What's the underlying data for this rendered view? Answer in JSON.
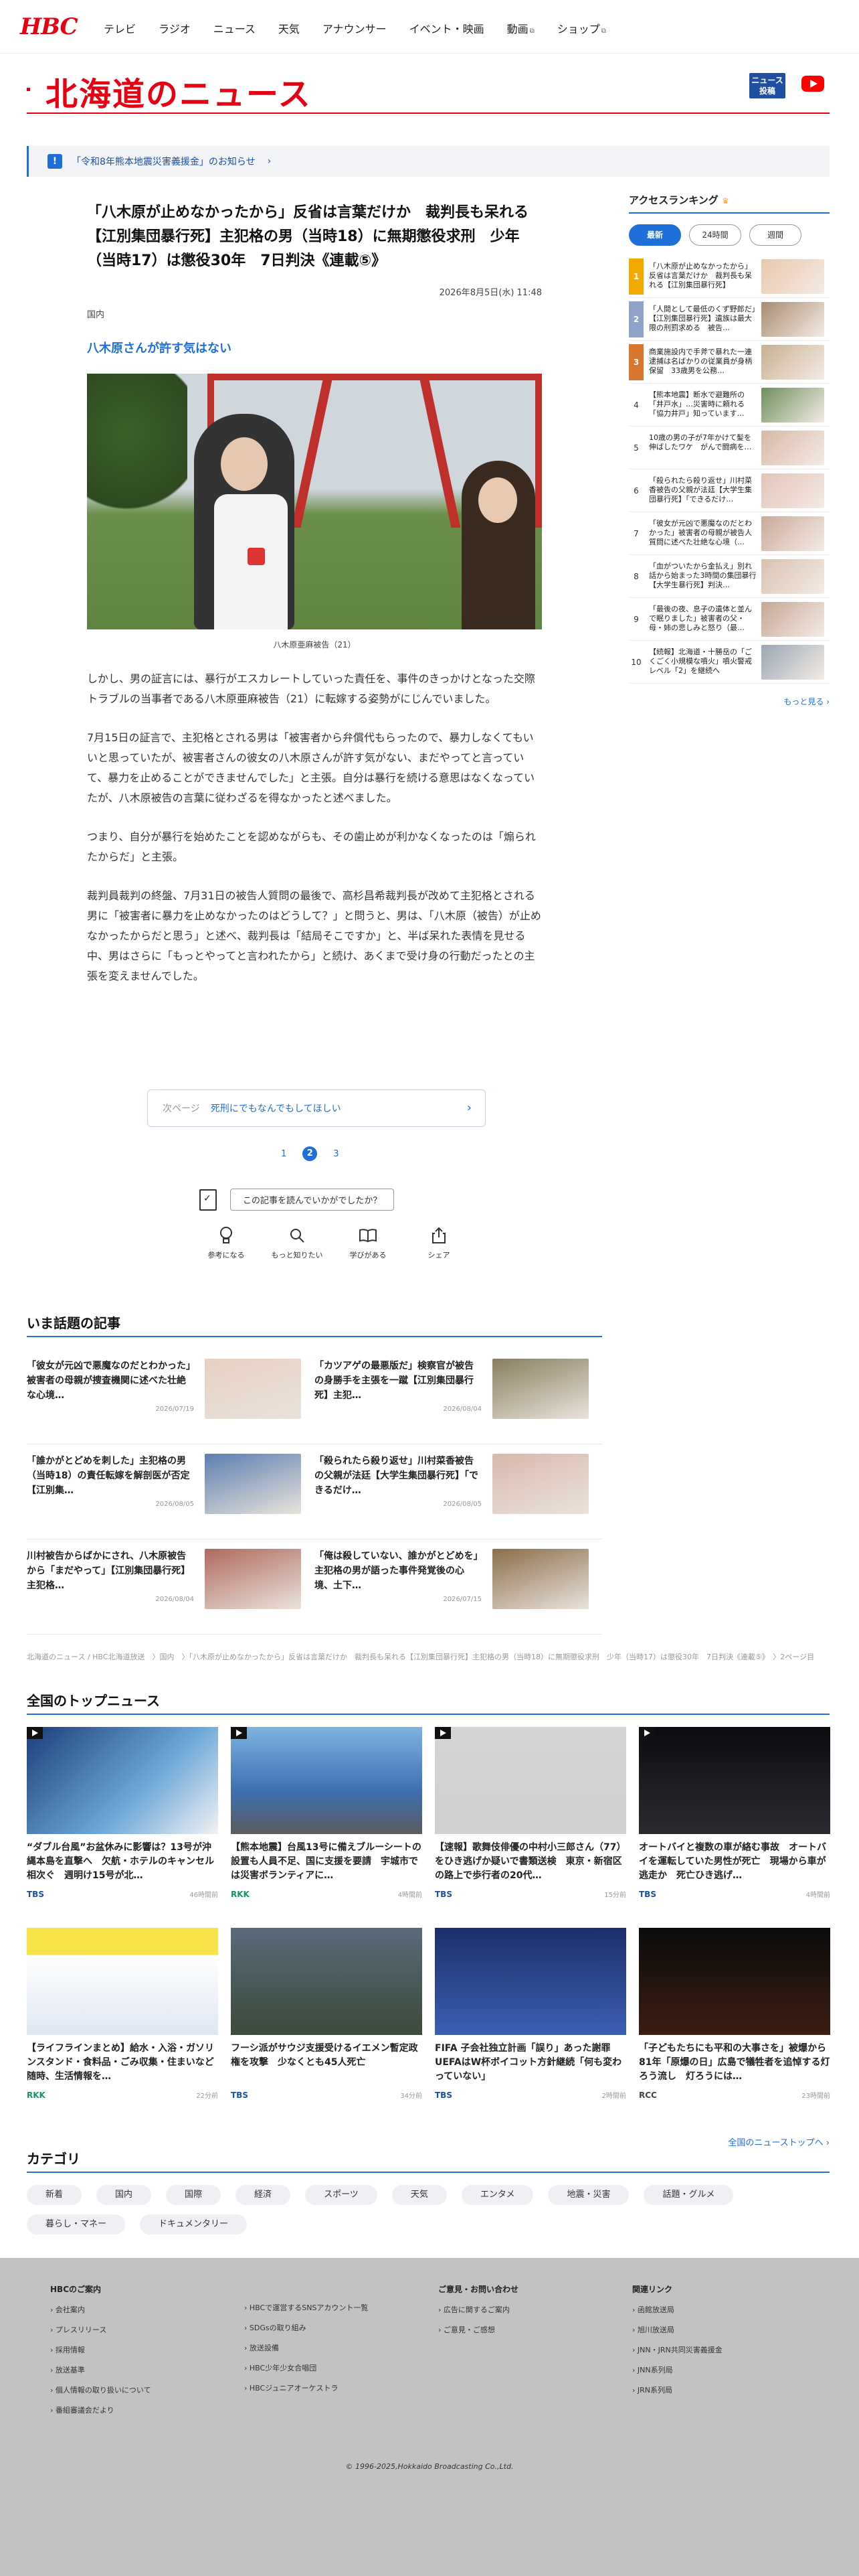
{
  "header": {
    "logo": "HBC",
    "nav": [
      "テレビ",
      "ラジオ",
      "ニュース",
      "天気",
      "アナウンサー",
      "イベント・映画",
      "動画",
      "ショップ"
    ]
  },
  "page": {
    "title": "北海道のニュース",
    "news_badge_line1": "ニュース",
    "news_badge_line2": "投稿"
  },
  "notice": {
    "icon": "!",
    "text": "「令和8年熊本地震災害義援金」のお知らせ",
    "chev": "›"
  },
  "article": {
    "title": "「八木原が止めなかったから」反省は言葉だけか　裁判長も呆れる【江別集団暴行死】主犯格の男（当時18）に無期懲役求刑　少年（当時17）は懲役30年　7日判決《連載⑤》",
    "date": "2026年8月5日(水) 11:48",
    "category": "国内",
    "subheading": "八木原さんが許す気はない",
    "caption": "八木原亜麻被告（21）",
    "paragraphs": [
      "しかし、男の証言には、暴行がエスカレートしていった責任を、事件のきっかけとなった交際トラブルの当事者である八木原亜麻被告（21）に転嫁する姿勢がにじんでいました。",
      "7月15日の証言で、主犯格とされる男は「被害者から弁償代もらったので、暴力しなくてもいいと思っていたが、被害者さんの彼女の八木原さんが許す気がない、まだやってと言っていて、暴力を止めることができませんでした」と主張。自分は暴行を続ける意思はなくなっていたが、八木原被告の言葉に従わざるを得なかったと述べました。",
      "つまり、自分が暴行を始めたことを認めながらも、その歯止めが利かなくなったのは「煽られたからだ」と主張。",
      "裁判員裁判の終盤、7月31日の被告人質問の最後で、高杉昌希裁判長が改めて主犯格とされる男に「被害者に暴力を止めなかったのはどうして？」と問うと、男は、「八木原（被告）が止めなかったからだと思う」と述べ、裁判長は「結局そこですか」と、半ば呆れた表情を見せる中、男はさらに「もっとやってと言われたから」と続け、あくまで受け身の行動だったとの主張を変えませんでした。"
    ],
    "next_label": "次ページ",
    "next_title": "死刑にでもなんでもしてほしい",
    "next_chev": "›",
    "pages": [
      "1",
      "2",
      "3"
    ],
    "survey_question": "この記事を読んでいかがでしたか？",
    "reactions": [
      "参考になる",
      "もっと知りたい",
      "学びがある",
      "シェア"
    ]
  },
  "ranking": {
    "heading": "アクセスランキング",
    "crown": "♛",
    "tabs": [
      "最新",
      "24時間",
      "週間"
    ],
    "items": [
      {
        "n": "1",
        "text": "「八木原が止めなかったから」反省は言葉だけか　裁判長も呆れる【江別集団暴行死】"
      },
      {
        "n": "2",
        "text": "「人間として最低のくず野郎だ」【江別集団暴行死】遺族は最大限の刑罰求める　被告…"
      },
      {
        "n": "3",
        "text": "商業施設内で手斧で暴れた一連逮捕は名ばかりの従業員が身柄保留　33歳男を公務…"
      },
      {
        "n": "4",
        "text": "【熊本地震】断水で避難所の「井戸水」…災害時に頼れる「協力井戸」知っています…"
      },
      {
        "n": "5",
        "text": "10歳の男の子が7年かけて髪を伸ばしたワケ　がんで闘病を…"
      },
      {
        "n": "6",
        "text": "「殺られたら殺り返せ」川村菜香被告の父親が法廷【大学生集団暴行死】「できるだけ…"
      },
      {
        "n": "7",
        "text": "「彼女が元凶で悪魔なのだとわかった」被害者の母親が被告人質問に述べた壮絶な心境（…"
      },
      {
        "n": "8",
        "text": "「血がついたから金払え」別れ話から始まった3時間の集団暴行【大学生暴行死】判決…"
      },
      {
        "n": "9",
        "text": "「最後の夜、息子の遺体と並んで眠りました」被害者の父・母・姉の悲しみと怒り（最…"
      },
      {
        "n": "10",
        "text": "【続報】北海道・十勝岳の「ごくごく小規模な噴火」噴火警戒レベル「2」を継続へ"
      }
    ],
    "more": "もっと見る ›"
  },
  "trending": {
    "heading": "いま話題の記事",
    "items": [
      {
        "title": "「彼女が元凶で悪魔なのだとわかった」被害者の母親が捜査機関に述べた壮絶な心境…",
        "date": "2026/07/19"
      },
      {
        "title": "「カツアゲの最悪版だ」検察官が被告の身勝手を主張を一蹴【江別集団暴行死】主犯…",
        "date": "2026/08/04"
      },
      {
        "title": "「誰かがとどめを刺した」主犯格の男（当時18）の責任転嫁を解剖医が否定【江別集…",
        "date": "2026/08/05"
      },
      {
        "title": "「殺られたら殺り返せ」川村菜香被告の父親が法廷【大学生集団暴行死】「できるだけ…",
        "date": "2026/08/05"
      },
      {
        "title": "川村被告からばかにされ、八木原被告から「まだやって」【江別集団暴行死】主犯格…",
        "date": "2026/08/04"
      },
      {
        "title": "「俺は殺していない、誰かがとどめを」主犯格の男が語った事件発覚後の心境、土下…",
        "date": "2026/07/15"
      }
    ]
  },
  "breadcrumb": "北海道のニュース / HBC北海道放送　〉国内　〉「八木原が止めなかったから」反省は言葉だけか　裁判長も呆れる【江別集団暴行死】主犯格の男（当時18）に無期懲役求刑　少年（当時17）は懲役30年　7日判決《連載⑤》　〉2ページ目",
  "national": {
    "heading": "全国のトップニュース",
    "items": [
      {
        "title": "“ダブル台風”お盆休みに影響は？13号が沖縄本島を直撃へ　欠航・ホテルのキャンセル相次ぐ　週明け15号が北…",
        "src": "TBS",
        "ago": "46時間前"
      },
      {
        "title": "【熊本地震】台風13号に備えブルーシートの設置も人員不足、国に支援を要請　宇城市では災害ボランティアに…",
        "src": "RKK",
        "ago": "4時間前"
      },
      {
        "title": "【速報】歌舞伎俳優の中村小三郎さん（77）をひき逃げか疑いで書類送検　東京・新宿区の路上で歩行者の20代…",
        "src": "TBS",
        "ago": "15分前"
      },
      {
        "title": "オートバイと複数の車が絡む事故　オートバイを運転していた男性が死亡　現場から車が逃走か　死亡ひき逃げ…",
        "src": "TBS",
        "ago": "4時間前"
      },
      {
        "title": "【ライフラインまとめ】給水・入浴・ガソリンスタンド・食料品・ごみ収集・住まいなど　随時、生活情報を…",
        "src": "RKK",
        "ago": "22分前"
      },
      {
        "title": "フーシ派がサウジ支援受けるイエメン暫定政権を攻撃　少なくとも45人死亡",
        "src": "TBS",
        "ago": "34分前"
      },
      {
        "title": "FIFA 子会社独立計画「誤り」あった謝罪　UEFAはW杯ボイコット方針継続「何も変わっていない」",
        "src": "TBS",
        "ago": "2時間前"
      },
      {
        "title": "「子どもたちにも平和の大事さを」被爆から81年「原爆の日」広島で犠牲者を追悼する灯ろう流し　灯ろうには…",
        "src": "RCC",
        "ago": "23時間前"
      }
    ],
    "more": "全国のニューストップへ ›"
  },
  "category": {
    "heading": "カテゴリ",
    "chips": [
      "新着",
      "国内",
      "国際",
      "経済",
      "スポーツ",
      "天気",
      "エンタメ",
      "地震・災害",
      "話題・グルメ",
      "暮らし・マネー",
      "ドキュメンタリー"
    ]
  },
  "footer": {
    "cols": [
      {
        "h": "HBCのご案内",
        "items": [
          "会社案内",
          "プレスリリース",
          "採用情報",
          "放送基準",
          "個人情報の取り扱いについて",
          "番組審議会だより"
        ]
      },
      {
        "h": "",
        "items": [
          "HBCで運営するSNSアカウント一覧",
          "SDGsの取り組み",
          "放送設備",
          "HBC少年少女合唱団",
          "HBCジュニアオーケストラ"
        ]
      },
      {
        "h": "ご意見・お問い合わせ",
        "items": [
          "広告に関するご案内",
          "ご意見・ご感想"
        ]
      },
      {
        "h": "関連リンク",
        "items": [
          "函館放送局",
          "旭川放送局",
          "JNN・JRN共同災害義援金",
          "JNN系列局",
          "JRN系列局"
        ]
      }
    ],
    "copyright": "© 1996-2025,Hokkaido Broadcasting Co.,Ltd."
  },
  "colors": {
    "brand_red": "#e60012",
    "accent_blue": "#1e6fd9",
    "footer_gray": "#c2c2c2"
  }
}
